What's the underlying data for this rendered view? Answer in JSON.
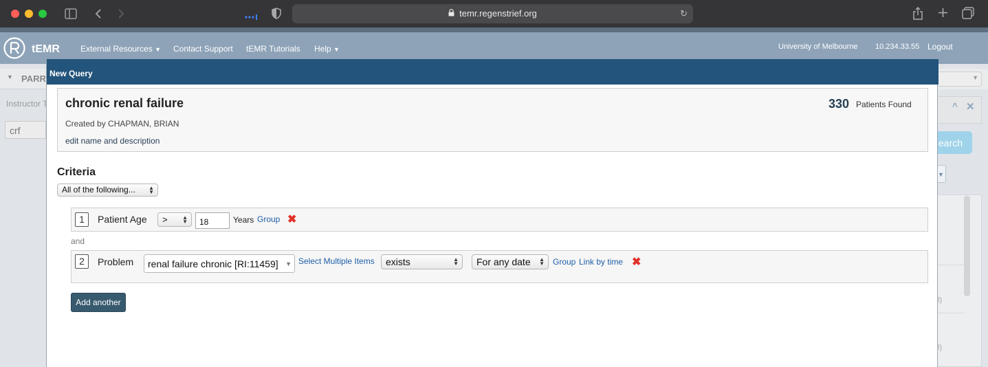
{
  "browser": {
    "url": "temr.regenstrief.org"
  },
  "app": {
    "logo_text": "tEMR",
    "nav": [
      "External Resources",
      "Contact Support",
      "tEMR Tutorials",
      "Help"
    ],
    "institution": "University of Melbourne",
    "ip": "10.234.33.55",
    "logout": "Logout"
  },
  "background": {
    "panel_title": "PARR",
    "instructor_label": "Instructor T",
    "search_value": "crf",
    "search_button": "earch",
    "side_text_1": "l)",
    "side_text_2": "l)"
  },
  "modal": {
    "title": "New Query",
    "query_name": "chronic renal failure",
    "patients_count": "330",
    "patients_label": "Patients Found",
    "created_by": "Created by CHAPMAN, BRIAN",
    "edit_link": "edit name and description",
    "criteria_heading": "Criteria",
    "criteria_mode": "All of the following...",
    "join_word": "and",
    "criteria": [
      {
        "index": "1",
        "label": "Patient Age",
        "operator": ">",
        "value": "18",
        "unit": "Years",
        "group_link": "Group"
      },
      {
        "index": "2",
        "label": "Problem",
        "item": "renal failure chronic [RI:11459]",
        "select_multiple": "Select Multiple Items",
        "condition": "exists",
        "date_scope": "For any date",
        "group_link": "Group",
        "link_by_time": "Link by time"
      }
    ],
    "add_button": "Add another"
  }
}
